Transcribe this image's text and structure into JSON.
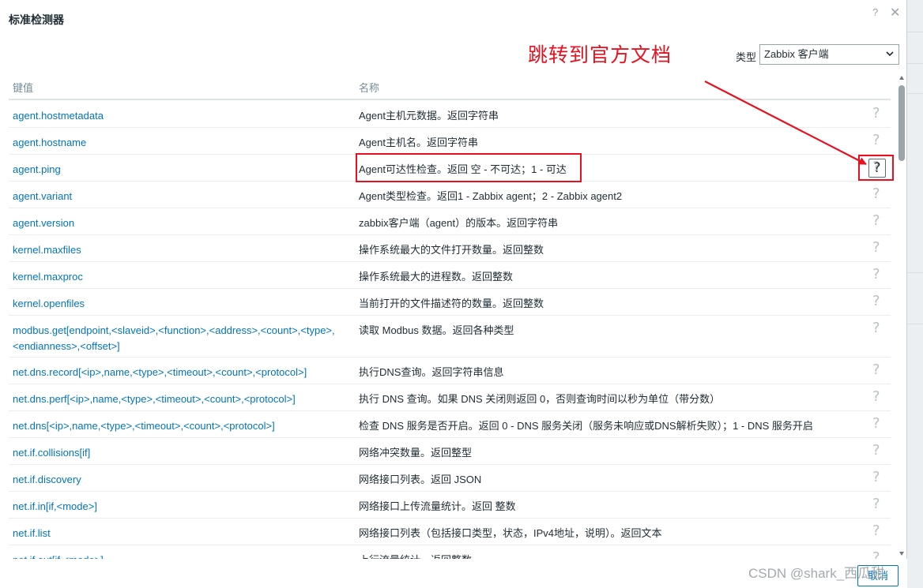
{
  "dialog": {
    "title": "标准检测器",
    "help_icon": "?",
    "close_icon": "✕"
  },
  "annotation": {
    "text": "跳转到官方文档",
    "color": "#e8101e"
  },
  "filter": {
    "type_label": "类型",
    "type_value": "Zabbix 客户端"
  },
  "table": {
    "columns": [
      "键值",
      "名称"
    ],
    "help_glyph": "?",
    "rows": [
      {
        "key": "agent.hostmetadata",
        "desc": "Agent主机元数据。返回字符串"
      },
      {
        "key": "agent.hostname",
        "desc": "Agent主机名。返回字符串"
      },
      {
        "key": "agent.ping",
        "desc": "Agent可达性检查。返回 空 - 不可达；1 - 可达"
      },
      {
        "key": "agent.variant",
        "desc": "Agent类型检查。返回1 - Zabbix agent；2 - Zabbix agent2"
      },
      {
        "key": "agent.version",
        "desc": "zabbix客户端（agent）的版本。返回字符串"
      },
      {
        "key": "kernel.maxfiles",
        "desc": "操作系统最大的文件打开数量。返回整数"
      },
      {
        "key": "kernel.maxproc",
        "desc": "操作系统最大的进程数。返回整数"
      },
      {
        "key": "kernel.openfiles",
        "desc": "当前打开的文件描述符的数量。返回整数"
      },
      {
        "key": "modbus.get[endpoint,<slaveid>,<function>,<address>,<count>,<type>,<endianness>,<offset>]",
        "desc": "读取 Modbus 数据。返回各种类型"
      },
      {
        "key": "net.dns.record[<ip>,name,<type>,<timeout>,<count>,<protocol>]",
        "desc": "执行DNS查询。返回字符串信息"
      },
      {
        "key": "net.dns.perf[<ip>,name,<type>,<timeout>,<count>,<protocol>]",
        "desc": "执行 DNS 查询。如果 DNS 关闭则返回 0，否则查询时间以秒为单位（带分数）"
      },
      {
        "key": "net.dns[<ip>,name,<type>,<timeout>,<count>,<protocol>]",
        "desc": "检查 DNS 服务是否开启。返回 0 - DNS 服务关闭（服务未响应或DNS解析失败）；1 - DNS 服务开启"
      },
      {
        "key": "net.if.collisions[if]",
        "desc": "网络冲突数量。返回整型"
      },
      {
        "key": "net.if.discovery",
        "desc": "网络接口列表。返回 JSON"
      },
      {
        "key": "net.if.in[if,<mode>]",
        "desc": "网络接口上传流量统计。返回 整数"
      },
      {
        "key": "net.if.list",
        "desc": "网络接口列表（包括接口类型，状态，IPv4地址，说明）。返回文本"
      },
      {
        "key": "net.if.out[if,<mode>]",
        "desc": "上行流量统计。返回整数"
      }
    ]
  },
  "footer": {
    "cancel_label": "取消",
    "watermark": "CSDN @shark_西瓜甜"
  }
}
